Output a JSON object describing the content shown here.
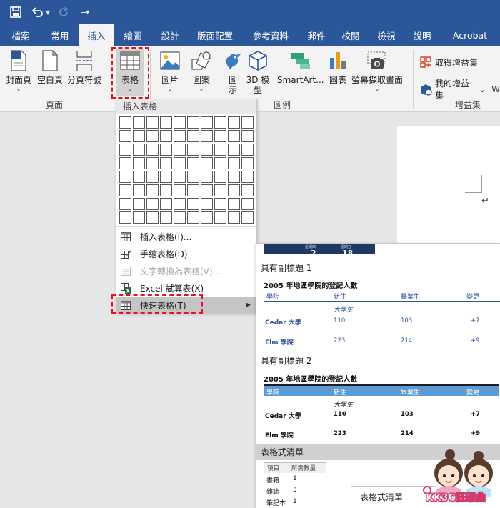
{
  "tabs": [
    "檔案",
    "常用",
    "插入",
    "繪圖",
    "設計",
    "版面配置",
    "參考資料",
    "郵件",
    "校閱",
    "檢視",
    "說明",
    "Acrobat"
  ],
  "ribbon": {
    "pages_group": {
      "cover": "封面頁",
      "blank": "空白頁",
      "page_break": "分頁符號",
      "label": "頁面"
    },
    "table_group": {
      "table": "表格"
    },
    "illustrations_group": {
      "picture": "圖片",
      "shapes": "圖案",
      "icons": "圖示",
      "model3d": "3D 模型",
      "smartart": "SmartArt...",
      "chart": "圖表",
      "screenshot": "螢幕擷取畫面",
      "label": "圖例"
    },
    "addins_group": {
      "get": "取得增益集",
      "my": "我的增益集",
      "label": "增益集",
      "more": "W"
    }
  },
  "menu": {
    "header": "插入表格",
    "items": [
      {
        "label": "插入表格(I)...",
        "icon": "table-icon",
        "disabled": false
      },
      {
        "label": "手繪表格(D)",
        "icon": "pencil-table-icon",
        "disabled": false
      },
      {
        "label": "文字轉換為表格(V)...",
        "icon": "convert-icon",
        "disabled": true
      },
      {
        "label": "Excel 試算表(X)",
        "icon": "excel-icon",
        "disabled": false
      },
      {
        "label": "快速表格(T)",
        "icon": "quick-table-icon",
        "disabled": false,
        "highlighted": true
      }
    ]
  },
  "gallery": {
    "calendar": {
      "days": [
        "星期四",
        "星期五"
      ],
      "nums": [
        "2",
        "18"
      ]
    },
    "sections": [
      {
        "title": "具有副標題 1"
      },
      {
        "title": "具有副標題 2"
      },
      {
        "title": "表格式清單"
      }
    ],
    "table1": {
      "title": "2005 年地區學院的登記人數",
      "headers": [
        "學院",
        "新生",
        "畢業生",
        "變更"
      ],
      "subhead": "大學生",
      "rows": [
        [
          "Cedar 大學",
          "110",
          "103",
          "+7"
        ],
        [
          "Elm 學院",
          "223",
          "214",
          "+9"
        ]
      ]
    },
    "table2": {
      "title": "2005 年地區學院的登記人數",
      "headers": [
        "學院",
        "新生",
        "畢業生",
        "變更"
      ],
      "subhead": "大學生",
      "rows": [
        [
          "Cedar 大學",
          "110",
          "103",
          "+7"
        ],
        [
          "Elm 學院",
          "223",
          "214",
          "+9"
        ]
      ]
    },
    "list": {
      "headers": [
        "項目",
        "所需數量"
      ],
      "rows": [
        [
          "書籍",
          "1"
        ],
        [
          "雜誌",
          "3"
        ],
        [
          "筆記本",
          "1"
        ]
      ]
    },
    "tooltip": "表格式清單"
  },
  "watermark": "KK3C狂想曲",
  "colors": {
    "brand": "#2b579a",
    "highlight": "#c5c5c5",
    "dash": "#e0141e",
    "table_blue": "#5b9bd5"
  }
}
